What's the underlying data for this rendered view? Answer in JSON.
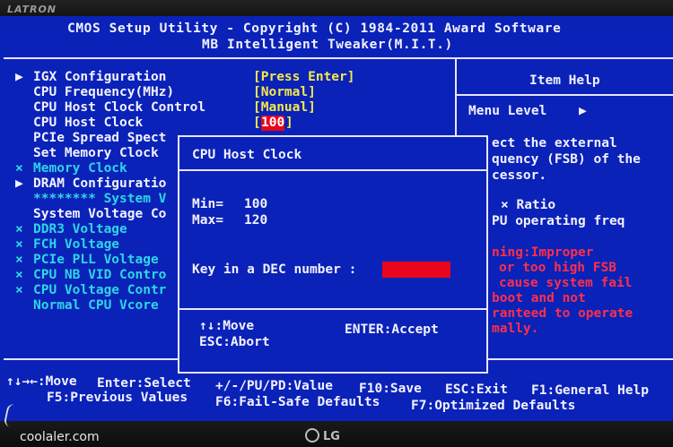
{
  "monitor": {
    "brand": "LATRON",
    "logo": "LG"
  },
  "watermark": "coolaler.com",
  "header": {
    "line1": "CMOS Setup Utility - Copyright (C) 1984-2011 Award Software",
    "line2": "MB Intelligent Tweaker(M.I.T.)"
  },
  "menu": [
    {
      "marker": "▶",
      "label": "IGX Configuration",
      "value": "[Press Enter]",
      "color": "white"
    },
    {
      "marker": "",
      "label": "CPU Frequency(MHz)",
      "value": "[Normal]",
      "color": "white"
    },
    {
      "marker": "",
      "label": "CPU Host Clock Control",
      "value": "[Manual]",
      "color": "white"
    },
    {
      "marker": "",
      "label": "CPU Host Clock",
      "value_open": "[",
      "value_selected": "100",
      "value_close": "]",
      "color": "white"
    },
    {
      "marker": "",
      "label": "PCIe Spread Spect",
      "value": "",
      "color": "white"
    },
    {
      "marker": "",
      "label": "Set Memory Clock",
      "value": "",
      "color": "white"
    },
    {
      "marker": "×",
      "label": "Memory Clock",
      "value": "",
      "color": "cyan"
    },
    {
      "marker": "▶",
      "label": "DRAM Configuratio",
      "value": "",
      "color": "white"
    },
    {
      "marker": "",
      "label": "******** System V",
      "value": "",
      "color": "cyan"
    },
    {
      "marker": "",
      "label": "System Voltage Co",
      "value": "",
      "color": "white"
    },
    {
      "marker": "×",
      "label": "DDR3 Voltage",
      "value": "",
      "color": "cyan"
    },
    {
      "marker": "×",
      "label": "FCH Voltage",
      "value": "",
      "color": "cyan"
    },
    {
      "marker": "×",
      "label": "PCIe PLL Voltage",
      "value": "",
      "color": "cyan"
    },
    {
      "marker": "×",
      "label": "CPU NB VID Contro",
      "value": "",
      "color": "cyan"
    },
    {
      "marker": "×",
      "label": "CPU Voltage Contr",
      "value": "",
      "color": "cyan"
    },
    {
      "marker": "",
      "label": "Normal CPU Vcore",
      "value": "",
      "color": "cyan"
    }
  ],
  "help": {
    "title": "Item Help",
    "menu_level_label": "Menu Level",
    "menu_level_arrow": "▶",
    "lines_white": [
      "ect the external",
      "quency (FSB) of the",
      "cessor."
    ],
    "lines_white2": [
      "× Ratio",
      "PU operating freq"
    ],
    "lines_red": [
      "ning:Improper",
      "or too high FSB",
      "cause system fail",
      "boot and not",
      "ranteed to operate",
      "mally."
    ]
  },
  "dialog": {
    "title": "CPU Host Clock",
    "min_label": "Min=",
    "min_value": "100",
    "max_label": "Max=",
    "max_value": "120",
    "prompt": "Key in a DEC number :",
    "input_value": "",
    "nav_move": "↑↓:Move",
    "nav_enter": "ENTER:Accept",
    "nav_abort": "ESC:Abort"
  },
  "footer": {
    "row1": [
      "↑↓→←:Move",
      "Enter:Select",
      "+/-/PU/PD:Value",
      "F10:Save",
      "ESC:Exit",
      "F1:General Help"
    ],
    "row2": [
      "F5:Previous Values",
      "F6:Fail-Safe Defaults",
      "F7:Optimized Defaults"
    ]
  },
  "colors": {
    "screen_bg": "#0a22b8",
    "text": "#e8e8ff",
    "value": "#f5e84a",
    "disabled": "#2fd6e6",
    "warning": "#ff2f4a",
    "input_bg": "#e8061c"
  }
}
